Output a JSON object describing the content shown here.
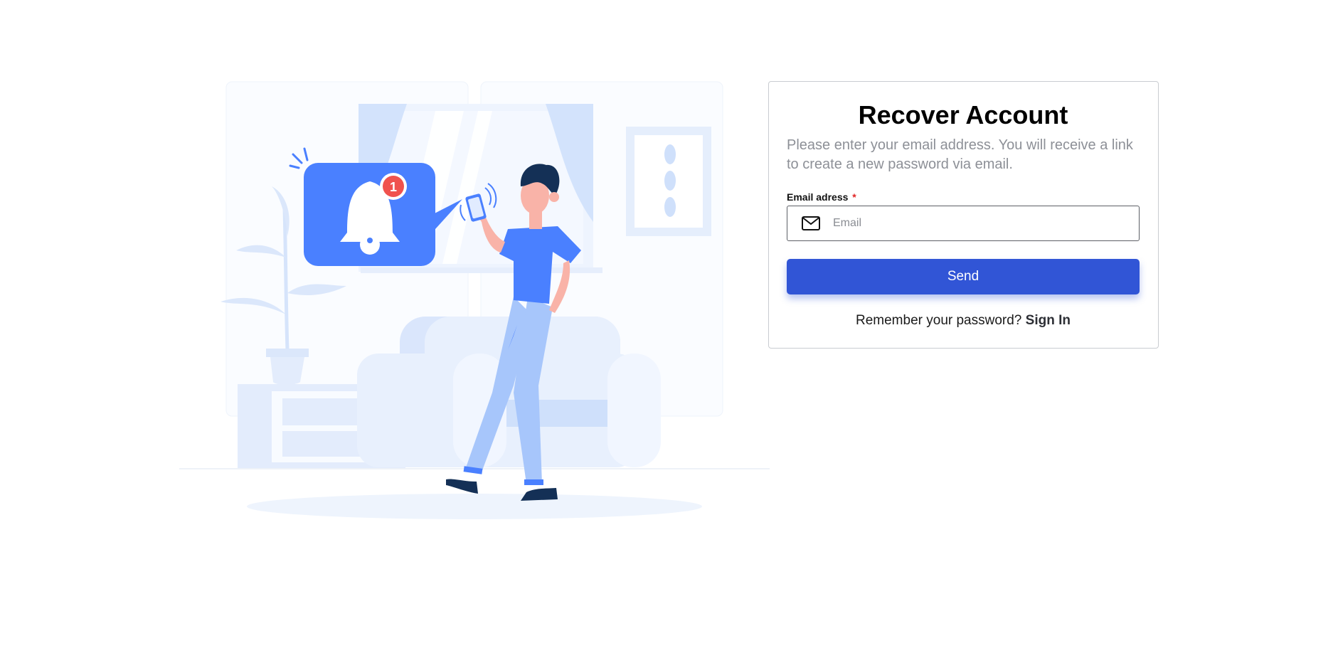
{
  "recover": {
    "title": "Recover Account",
    "description": "Please enter your email address. You will receive a link to create a new password via email.",
    "email_label": "Email adress",
    "required_marker": "*",
    "email_placeholder": "Email",
    "email_value": "",
    "send_label": "Send",
    "footer_text": "Remember your password?",
    "signin_label": "Sign In"
  },
  "illustration": {
    "notification_count": "1"
  },
  "colors": {
    "accent": "#3155d6",
    "illustration_blue": "#4a80ff",
    "light_blue": "#cfe0fb",
    "required": "#e02424"
  },
  "icons": {
    "email_field": "mail-icon"
  }
}
